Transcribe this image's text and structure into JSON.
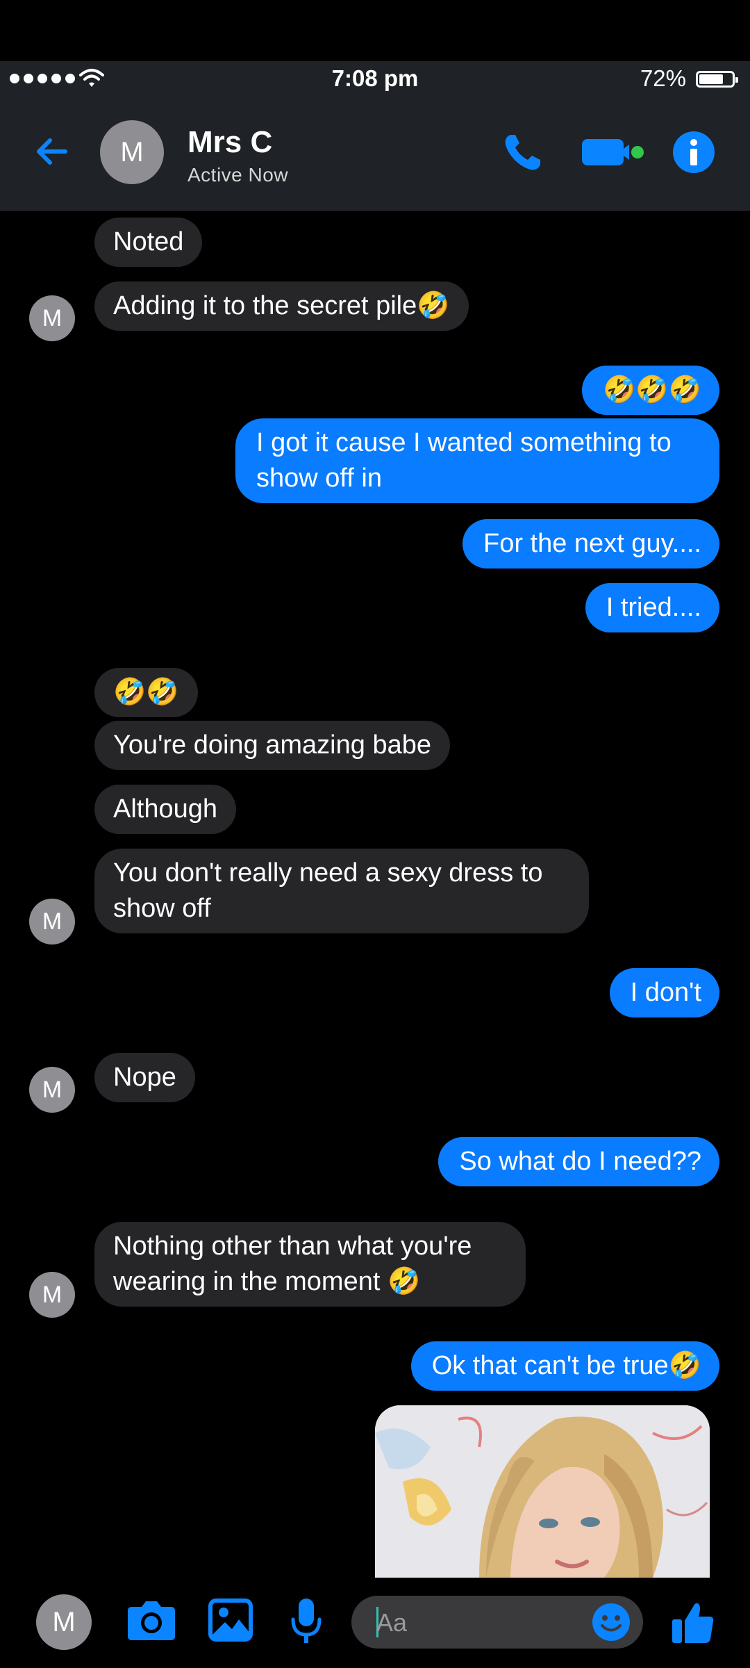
{
  "status_bar": {
    "time": "7:08 pm",
    "battery": "72%",
    "battery_level": 0.72
  },
  "header": {
    "avatar_initial": "M",
    "contact_name": "Mrs C",
    "contact_status": "Active Now"
  },
  "messages": [
    {
      "dir": "in",
      "text": "Noted"
    },
    {
      "dir": "in",
      "text": "Adding it to the secret pile🤣"
    },
    {
      "dir": "out",
      "text": "🤣🤣🤣"
    },
    {
      "dir": "out",
      "text": "I got it cause I wanted something to show off in"
    },
    {
      "dir": "out",
      "text": "For the next guy...."
    },
    {
      "dir": "out",
      "text": "I tried...."
    },
    {
      "dir": "in",
      "text": "🤣🤣"
    },
    {
      "dir": "in",
      "text": "You're doing amazing babe"
    },
    {
      "dir": "in",
      "text": "Although"
    },
    {
      "dir": "in",
      "text": "You don't really need a sexy dress to show off"
    },
    {
      "dir": "out",
      "text": "I don't"
    },
    {
      "dir": "in",
      "text": "Nope"
    },
    {
      "dir": "out",
      "text": "So what do I need??"
    },
    {
      "dir": "in",
      "text": "Nothing other than what you're wearing in the moment 🤣"
    },
    {
      "dir": "out",
      "text": "Ok that can't be true🤣"
    }
  ],
  "avatar_initial": "M",
  "composer": {
    "avatar_initial": "M",
    "placeholder": "Aa"
  },
  "colors": {
    "accent": "#0a7cff",
    "incoming_bubble": "#262629",
    "header_bg": "#1f2226",
    "online_dot": "#31c84a"
  },
  "icons": [
    "back-arrow-icon",
    "phone-icon",
    "video-camera-icon",
    "info-icon",
    "camera-icon",
    "image-icon",
    "microphone-icon",
    "emoji-icon",
    "thumbs-up-icon"
  ]
}
